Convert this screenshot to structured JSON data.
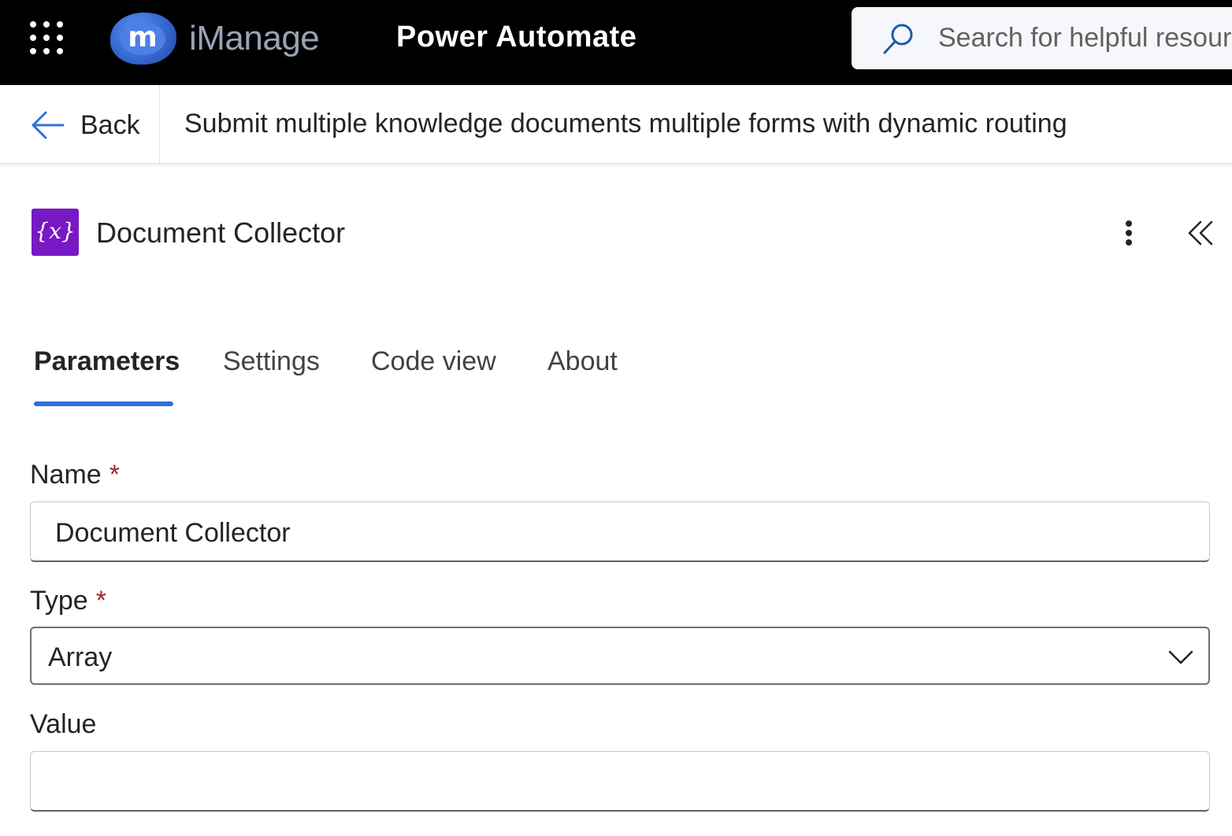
{
  "header": {
    "brand": "iManage",
    "brand_mark": "m",
    "app_title": "Power Automate",
    "search_placeholder": "Search for helpful resources"
  },
  "subheader": {
    "back_label": "Back",
    "flow_title": "Submit multiple knowledge documents multiple forms with dynamic routing"
  },
  "action": {
    "icon_text": "{x}",
    "title": "Document Collector"
  },
  "tabs": [
    {
      "label": "Parameters",
      "active": true
    },
    {
      "label": "Settings",
      "active": false
    },
    {
      "label": "Code view",
      "active": false
    },
    {
      "label": "About",
      "active": false
    }
  ],
  "form": {
    "name_label": "Name",
    "name_required": "*",
    "name_value": "Document Collector",
    "type_label": "Type",
    "type_required": "*",
    "type_value": "Array",
    "value_label": "Value",
    "value_value": ""
  },
  "colors": {
    "topbar": "#000000",
    "accent": "#2f6fe0",
    "action_icon_bg": "#7719c4",
    "required": "#a4262c"
  }
}
